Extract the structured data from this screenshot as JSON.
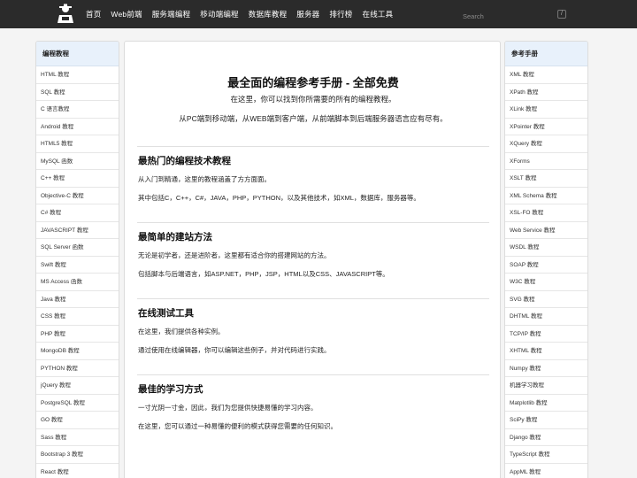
{
  "topnav": {
    "items": [
      "首页",
      "Web前端",
      "服务端编程",
      "移动端编程",
      "数据库教程",
      "服务器",
      "排行榜",
      "在线工具"
    ],
    "search_placeholder": "Search",
    "search_shortcut": "/"
  },
  "left_sidebar": {
    "title": "编程教程",
    "items": [
      "HTML 教程",
      "SQL 教程",
      "C 语言教程",
      "Android 教程",
      "HTML5 教程",
      "MySQL 函数",
      "C++ 教程",
      "Objective-C 教程",
      "C# 教程",
      "JAVASCRIPT 教程",
      "SQL Server 函数",
      "Swift 教程",
      "MS Access 函数",
      "Java 教程",
      "CSS 教程",
      "PHP 教程",
      "MongoDB 教程",
      "PYTHON 教程",
      "jQuery 教程",
      "PostgreSQL 教程",
      "GO 教程",
      "Sass 教程",
      "Bootstrap 3 教程",
      "React 教程"
    ]
  },
  "right_sidebar": {
    "title": "参考手册",
    "items": [
      "XML 教程",
      "XPath 教程",
      "XLink 教程",
      "XPointer 教程",
      "XQuery 教程",
      "XForms",
      "XSLT 教程",
      "XML Schema 教程",
      "XSL-FO 教程",
      "Web Service 教程",
      "WSDL 教程",
      "SOAP 教程",
      "W3C 教程",
      "SVG 教程",
      "DHTML 教程",
      "TCP/IP 教程",
      "XHTML 教程",
      "Numpy 教程",
      "机器学习教程",
      "Matplotlib 教程",
      "SciPy 教程",
      "Django 教程",
      "TypeScript 教程",
      "AppML 教程"
    ]
  },
  "hero": {
    "title": "最全面的编程参考手册 - 全部免费",
    "subtitle1": "在这里，你可以找到你所需要的所有的编程教程。",
    "subtitle2": "从PC端到移动端，从WEB端到客户端，从前端脚本到后端服务器语言应有尽有。"
  },
  "sections": [
    {
      "title": "最热门的编程技术教程",
      "lines": [
        "从入门到精通，这里的教程涵盖了方方面面。",
        "其中包括C，C++，C#，JAVA，PHP，PYTHON，以及其他技术，如XML，数据库，服务器等。"
      ]
    },
    {
      "title": "最简单的建站方法",
      "lines": [
        "无论是初学者，还是进阶者，这里都有适合你的搭建网站的方法。",
        "包括脚本与后端语言，如ASP.NET，PHP，JSP，HTML以及CSS、JAVASCRIPT等。"
      ]
    },
    {
      "title": "在线测试工具",
      "lines": [
        "在这里，我们提供各种实例。",
        "通过使用在线编辑器，你可以编辑这些例子，并对代码进行实践。"
      ]
    },
    {
      "title": "最佳的学习方式",
      "lines": [
        "一寸光阴一寸金，因此，我们为您提供快捷易懂的学习内容。",
        "在这里，您可以通过一种易懂的便利的模式获得您需要的任何知识。"
      ]
    }
  ]
}
